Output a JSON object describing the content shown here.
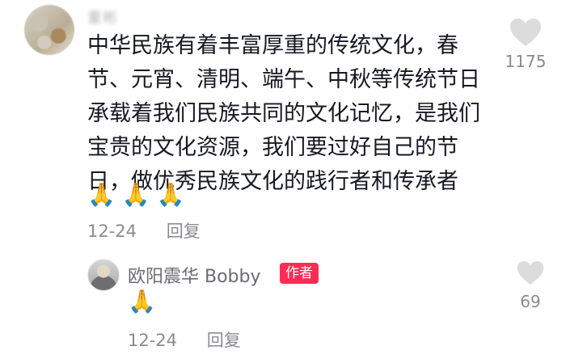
{
  "comment": {
    "username": "重彬",
    "text": "中华民族有着丰富厚重的传统文化，春节、元宵、清明、端午、中秋等传统节日承载着我们民族共同的文化记忆，是我们宝贵的文化资源，我们要过好自己的节日，做优秀民族文化的践行者和传承者",
    "emojis": "🙏🙏🙏",
    "date": "12-24",
    "reply_label": "回复",
    "like_count": "1175"
  },
  "reply": {
    "username": "欧阳震华 Bobby",
    "badge": "作者",
    "emojis": "🙏",
    "date": "12-24",
    "reply_label": "回复",
    "like_count": "69"
  },
  "colors": {
    "badge": "#fe2c55",
    "heart": "#dcdcdc",
    "meta": "#8a8b91"
  },
  "icons": {
    "like": "heart-icon",
    "emoji": "folded-hands-emoji"
  }
}
